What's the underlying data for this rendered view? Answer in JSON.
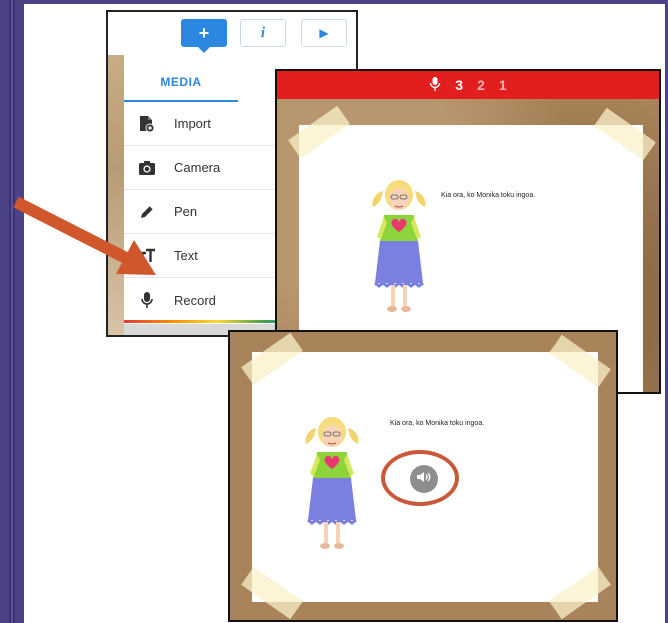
{
  "toolbar": {
    "add_label": "+",
    "info_label": "i",
    "play_label": "▶"
  },
  "media_menu": {
    "tab_label": "MEDIA",
    "items": [
      {
        "label": "Import",
        "icon": "import-icon"
      },
      {
        "label": "Camera",
        "icon": "camera-icon"
      },
      {
        "label": "Pen",
        "icon": "pen-icon"
      },
      {
        "label": "Text",
        "icon": "text-icon"
      },
      {
        "label": "Record",
        "icon": "microphone-icon"
      }
    ]
  },
  "recording": {
    "countdown": [
      "3",
      "2",
      "1"
    ],
    "page_text": "Kia ora, ko Monika toku ingoa."
  },
  "playback": {
    "page_text": "Kia ora, ko Monika toku ingoa.",
    "speaker_icon": "speaker-icon"
  },
  "colors": {
    "accent": "#2b87e0",
    "record_bar": "#e31e1e",
    "arrow": "#d0562c",
    "highlight_ring": "#c9593a",
    "frame": "#4c4386"
  }
}
